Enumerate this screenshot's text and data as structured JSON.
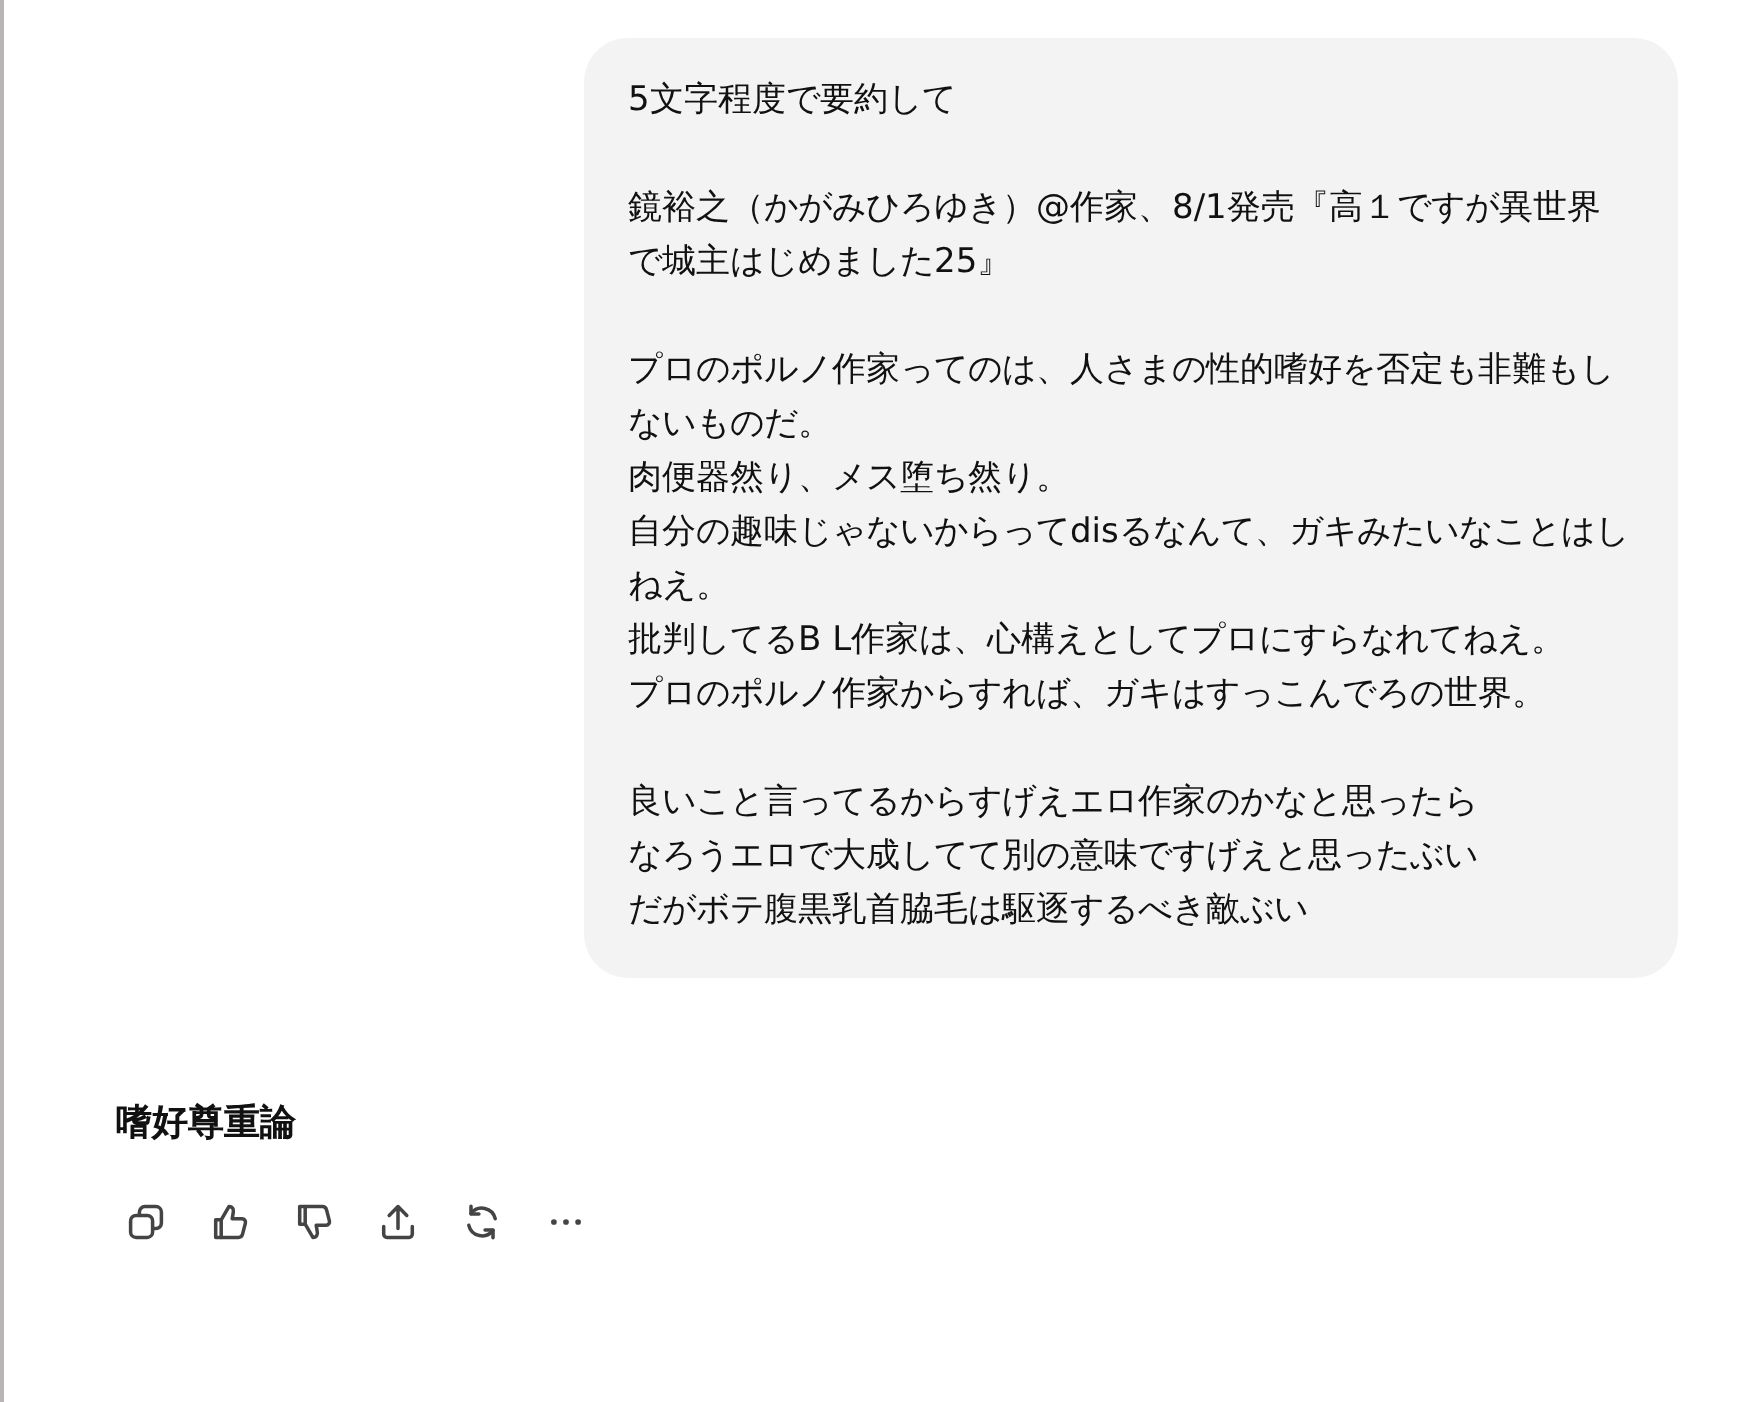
{
  "user_message": {
    "paragraphs": [
      [
        "5文字程度で要約して"
      ],
      [
        "鏡裕之（かがみひろゆき）@作家、8/1発売『高１ですが異世界で城主はじめました25』"
      ],
      [
        "プロのポルノ作家ってのは、人さまの性的嗜好を否定も非難もしないものだ。",
        "肉便器然り、メス堕ち然り。",
        "自分の趣味じゃないからってdisるなんて、ガキみたいなことはしねえ。",
        "批判してるB L作家は、心構えとしてプロにすらなれてねえ。",
        "プロのポルノ作家からすれば、ガキはすっこんでろの世界。"
      ],
      [
        "良いこと言ってるからすげえエロ作家のかなと思ったら",
        "なろうエロで大成してて別の意味ですげえと思ったぶい",
        "だがボテ腹黒乳首脇毛は駆逐するべき敵ぶい"
      ]
    ]
  },
  "reply": {
    "text": "嗜好尊重論"
  },
  "actions": [
    {
      "kind": "copy"
    },
    {
      "kind": "like"
    },
    {
      "kind": "dislike"
    },
    {
      "kind": "share"
    },
    {
      "kind": "retry"
    },
    {
      "kind": "more"
    }
  ]
}
